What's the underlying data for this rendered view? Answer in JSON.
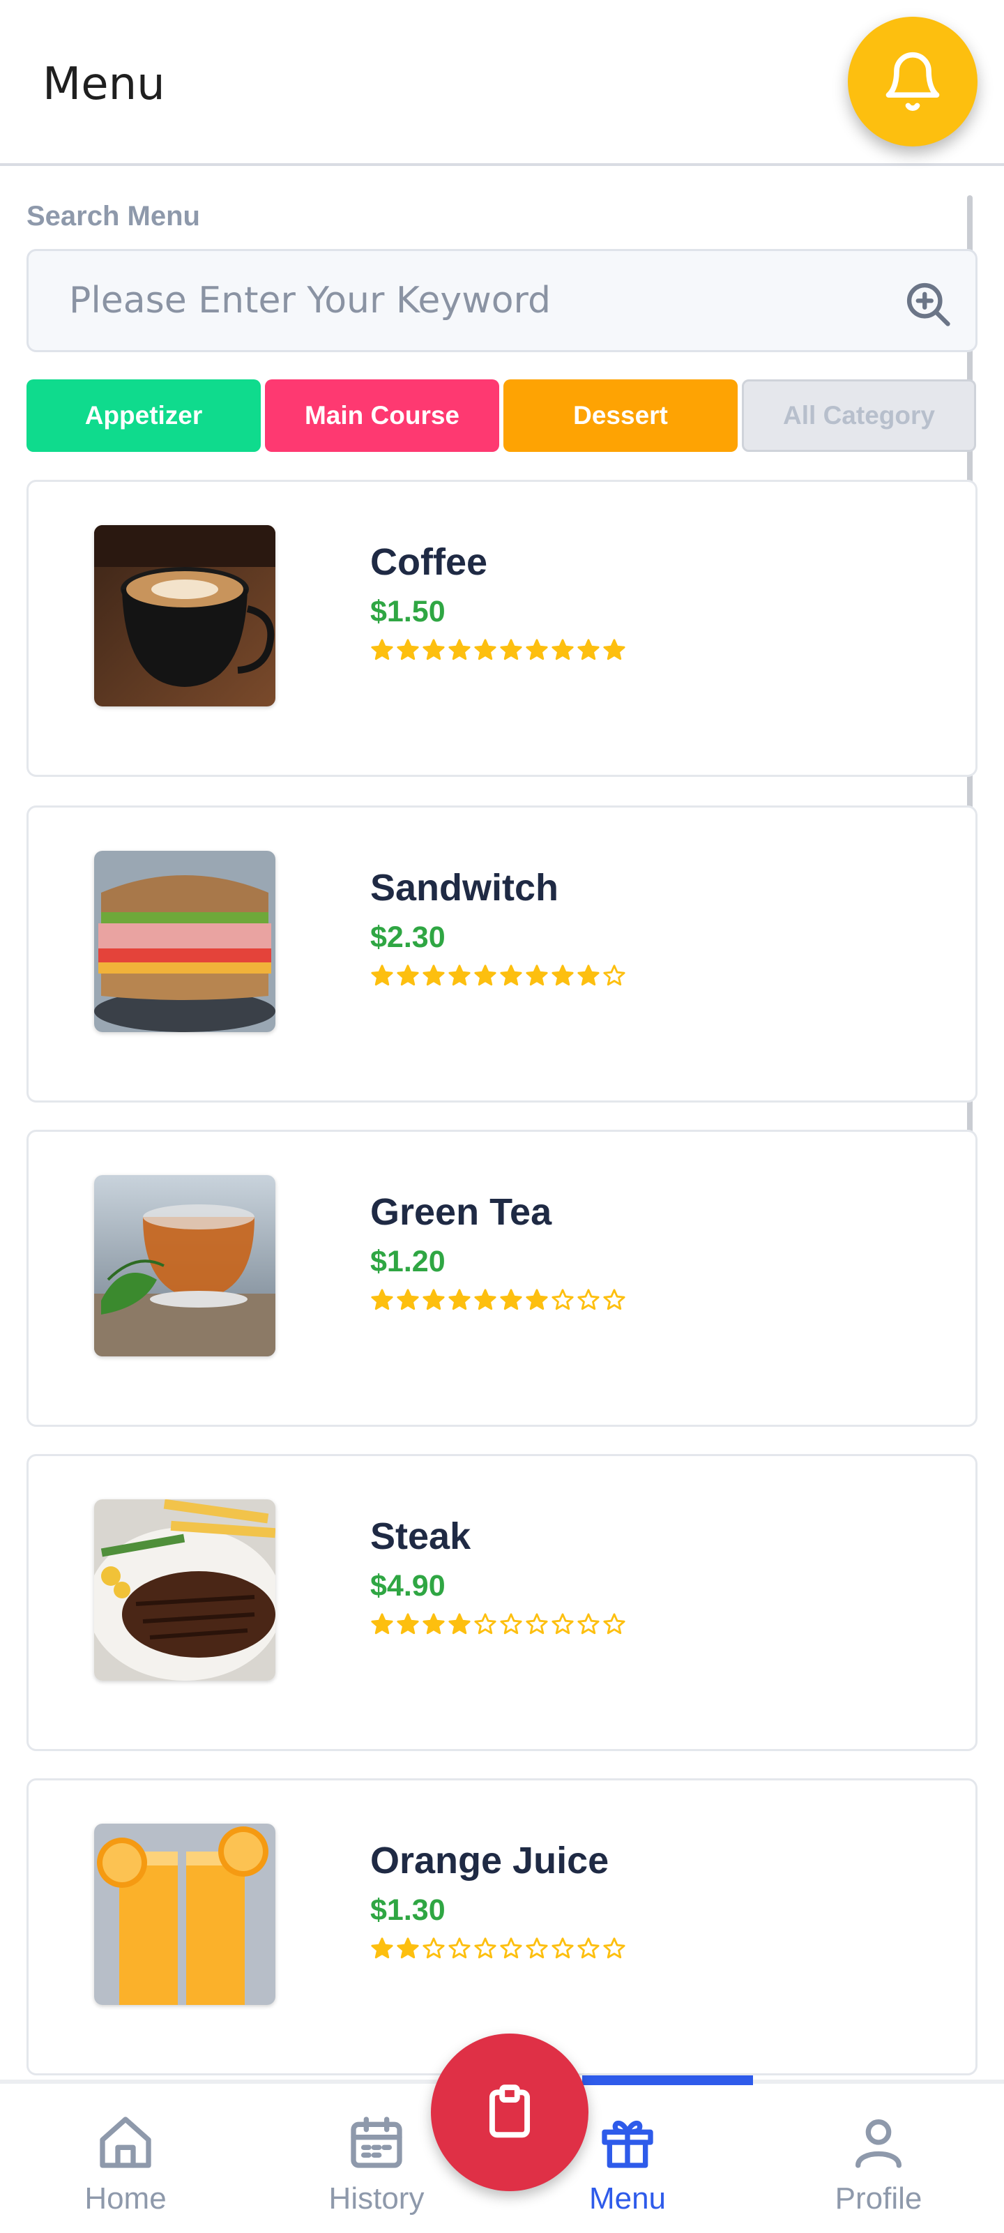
{
  "header": {
    "title": "Menu",
    "bell_icon": "bell-icon"
  },
  "search": {
    "label": "Search Menu",
    "placeholder": "Please Enter Your Keyword",
    "value": "",
    "icon": "zoom-in-icon"
  },
  "categories": [
    {
      "label": "Appetizer",
      "color": "#0fdb8d"
    },
    {
      "label": "Main Course",
      "color": "#fe3971"
    },
    {
      "label": "Dessert",
      "color": "#fea303"
    },
    {
      "label": "All Category",
      "color": "#e5e7ec"
    }
  ],
  "menu_items": [
    {
      "name": "Coffee",
      "price": "$1.50",
      "rating": 10,
      "max_rating": 10
    },
    {
      "name": "Sandwitch",
      "price": "$2.30",
      "rating": 9,
      "max_rating": 10
    },
    {
      "name": "Green Tea",
      "price": "$1.20",
      "rating": 7,
      "max_rating": 10
    },
    {
      "name": "Steak",
      "price": "$4.90",
      "rating": 4,
      "max_rating": 10
    },
    {
      "name": "Orange Juice",
      "price": "$1.30",
      "rating": 2,
      "max_rating": 10
    }
  ],
  "colors": {
    "accent": "#2e5bea",
    "price": "#2fa643",
    "star": "#fdbf0f",
    "fab": "#df3046",
    "bell": "#fdbf0f"
  },
  "bottom_nav": {
    "items": [
      {
        "label": "Home",
        "icon": "home-icon"
      },
      {
        "label": "History",
        "icon": "calendar-icon"
      },
      {
        "label": "Menu",
        "icon": "gift-icon",
        "active": true
      },
      {
        "label": "Profile",
        "icon": "user-icon"
      }
    ],
    "fab_icon": "clipboard-icon"
  }
}
